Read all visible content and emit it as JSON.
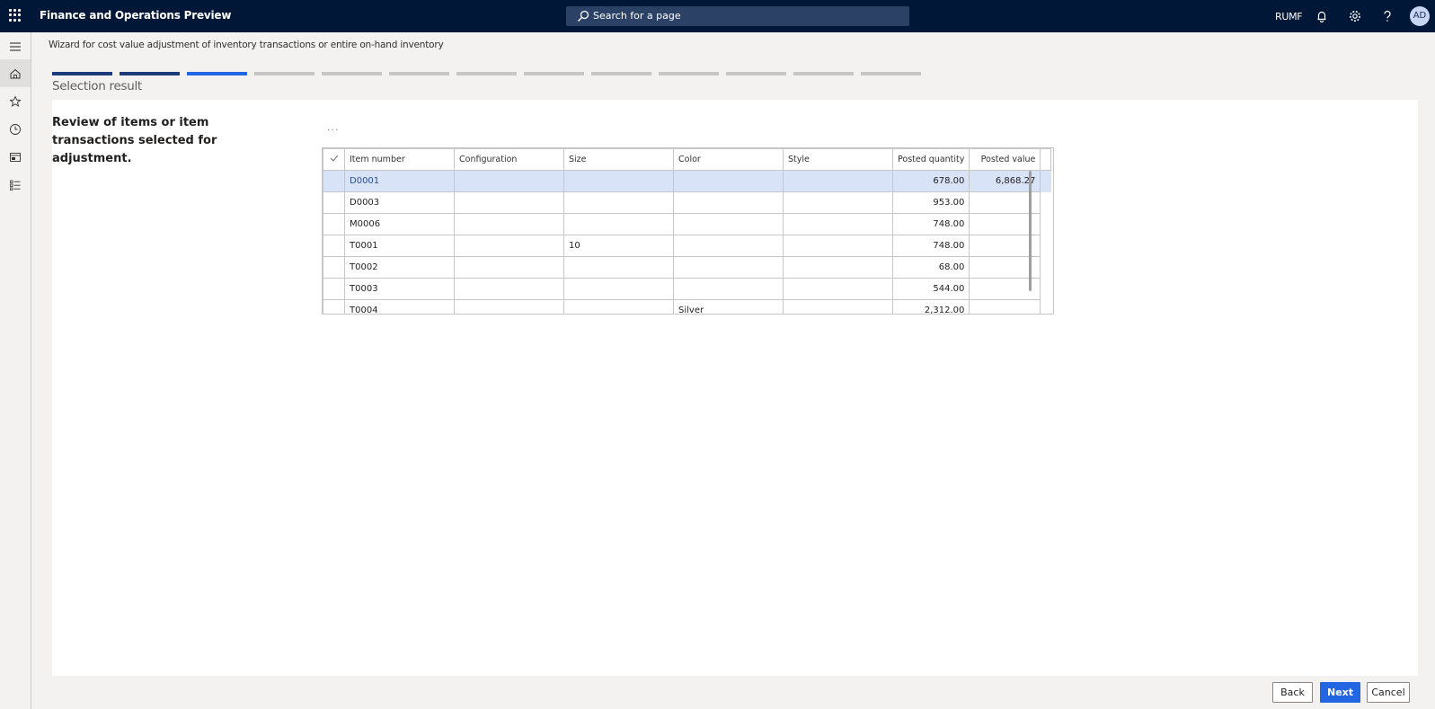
{
  "topbar": {
    "app_title": "Finance and Operations Preview",
    "search_placeholder": "Search for a page",
    "company": "RUMF",
    "avatar_initials": "AD"
  },
  "sidenav": {
    "items": [
      "menu",
      "home",
      "favorites",
      "recent",
      "workspaces",
      "modules"
    ]
  },
  "wizard": {
    "title": "Wizard for cost value adjustment of inventory transactions or entire on-hand inventory",
    "steps_total": 13,
    "steps_completed": 2,
    "current_step": 3,
    "step_title": "Selection result",
    "instruction": "Review of items or item transactions selected for adjustment.",
    "more_label": "..."
  },
  "grid": {
    "columns": [
      "Item number",
      "Configuration",
      "Size",
      "Color",
      "Style",
      "Posted quantity",
      "Posted value"
    ],
    "rows": [
      {
        "item": "D0001",
        "configuration": "",
        "size": "",
        "color": "",
        "style": "",
        "posted_quantity": "678.00",
        "posted_value": "6,868.27",
        "selected": true
      },
      {
        "item": "D0003",
        "configuration": "",
        "size": "",
        "color": "",
        "style": "",
        "posted_quantity": "953.00",
        "posted_value": ""
      },
      {
        "item": "M0006",
        "configuration": "",
        "size": "",
        "color": "",
        "style": "",
        "posted_quantity": "748.00",
        "posted_value": ""
      },
      {
        "item": "T0001",
        "configuration": "",
        "size": "10",
        "color": "",
        "style": "",
        "posted_quantity": "748.00",
        "posted_value": ""
      },
      {
        "item": "T0002",
        "configuration": "",
        "size": "",
        "color": "",
        "style": "",
        "posted_quantity": "68.00",
        "posted_value": ""
      },
      {
        "item": "T0003",
        "configuration": "",
        "size": "",
        "color": "",
        "style": "",
        "posted_quantity": "544.00",
        "posted_value": ""
      },
      {
        "item": "T0004",
        "configuration": "",
        "size": "",
        "color": "Silver",
        "style": "",
        "posted_quantity": "2,312.00",
        "posted_value": ""
      }
    ]
  },
  "footer": {
    "back_label": "Back",
    "next_label": "Next",
    "cancel_label": "Cancel"
  }
}
